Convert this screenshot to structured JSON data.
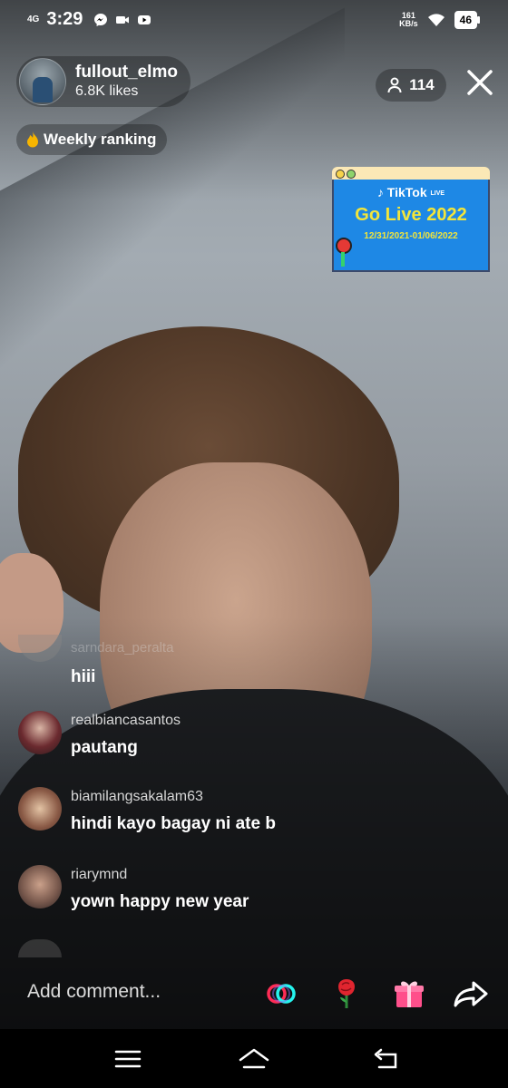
{
  "status_bar": {
    "network": "4G",
    "time": "3:29",
    "speed_top": "161",
    "speed_unit": "KB/s",
    "battery": "46"
  },
  "host": {
    "name": "fullout_elmo",
    "likes": "6.8K likes"
  },
  "viewers": {
    "count": "114"
  },
  "ranking": {
    "label": "Weekly ranking"
  },
  "promo": {
    "brand": "TikTok",
    "brand_tag": "LIVE",
    "title": "Go Live 2022",
    "dates": "12/31/2021-01/06/2022"
  },
  "comments": {
    "faded_user": "sarndara_peralta",
    "solo_text": "hiii",
    "items": [
      {
        "user": "realbiancasantos",
        "text": "pautang",
        "avatar_color": "#6b2a2f"
      },
      {
        "user": "biamilangsakalam63",
        "text": "hindi kayo bagay ni ate b",
        "avatar_color": "#8a5a46"
      },
      {
        "user": "riarymnd",
        "text": "yown happy new year",
        "avatar_color": "#caa08a"
      }
    ]
  },
  "composer": {
    "placeholder": "Add comment..."
  },
  "icons": {
    "link": "link-icon",
    "rose": "rose-gift-icon",
    "gift": "gift-icon",
    "share": "share-icon"
  },
  "colors": {
    "promo_blue": "#1e88e5",
    "promo_yellow": "#f3e53a",
    "gift_pink": "#ff4f8b",
    "link_red": "#fe2c55",
    "link_blue": "#25f4ee"
  }
}
